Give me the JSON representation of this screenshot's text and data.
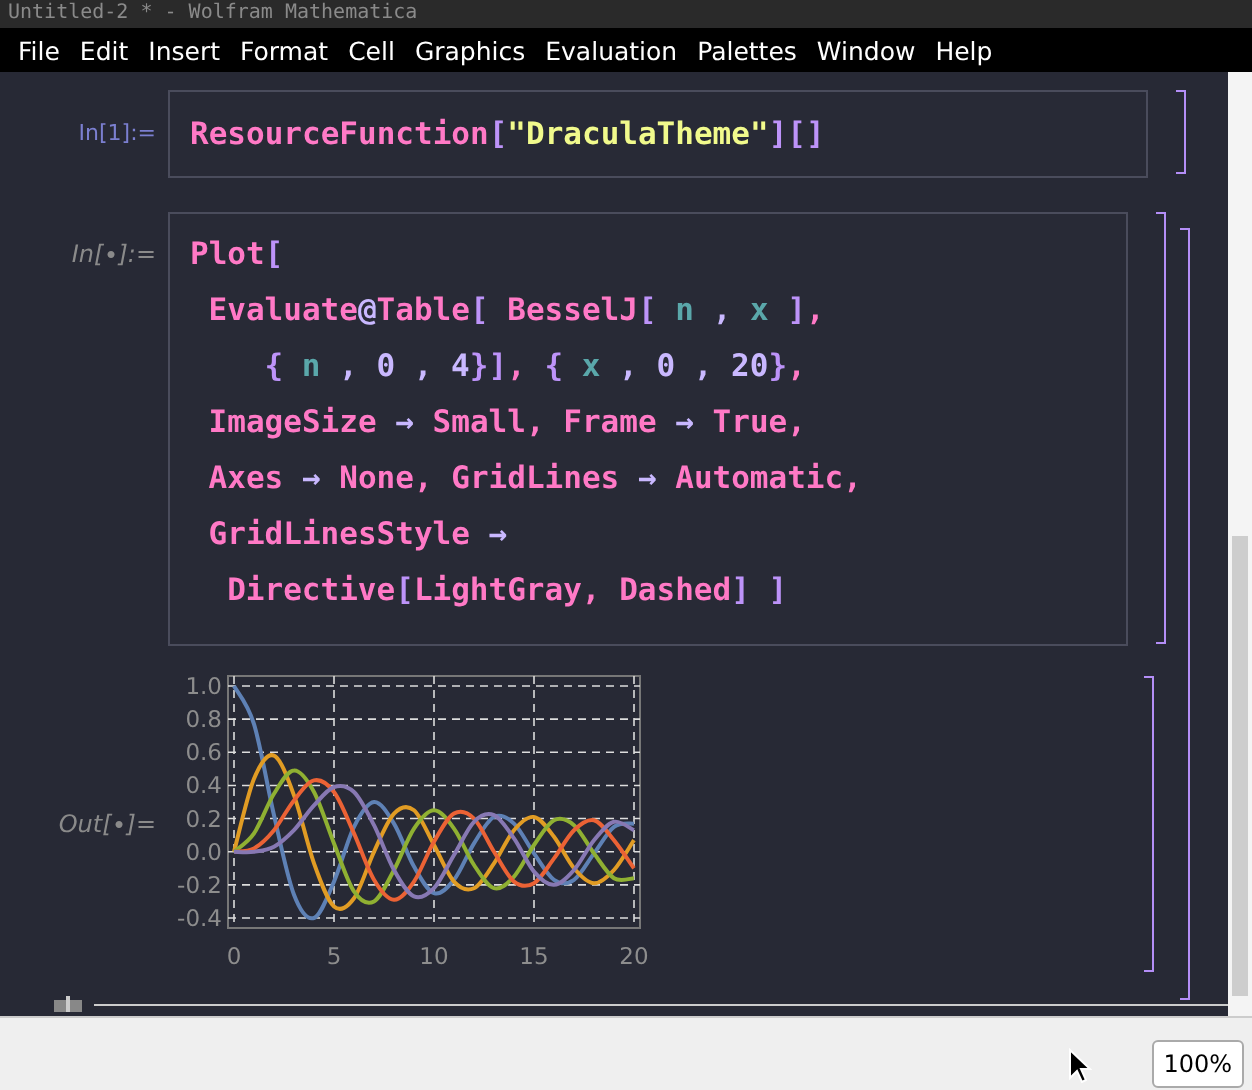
{
  "window": {
    "title": "Untitled-2 * - Wolfram Mathematica"
  },
  "menu": [
    "File",
    "Edit",
    "Insert",
    "Format",
    "Cell",
    "Graphics",
    "Evaluation",
    "Palettes",
    "Window",
    "Help"
  ],
  "cells": [
    {
      "kind": "input",
      "evaluated": true,
      "label": "In[1]:=",
      "lines": [
        [
          {
            "text": "ResourceFunction",
            "kind": "function"
          },
          {
            "text": "[",
            "kind": "bracket"
          },
          {
            "text": "\"DraculaTheme\"",
            "kind": "string"
          },
          {
            "text": "]",
            "kind": "bracket"
          },
          {
            "text": "[]",
            "kind": "bracket"
          }
        ]
      ]
    },
    {
      "kind": "input",
      "evaluated": false,
      "label": "In[∙]:=",
      "lines": [
        [
          {
            "text": "Plot",
            "kind": "function"
          },
          {
            "text": "[",
            "kind": "bracket"
          }
        ],
        [
          {
            "text": "Evaluate",
            "kind": "function"
          },
          {
            "text": "@",
            "kind": "operator"
          },
          {
            "text": "Table",
            "kind": "function"
          },
          {
            "text": "[ ",
            "kind": "bracket"
          },
          {
            "text": "BesselJ",
            "kind": "function"
          },
          {
            "text": "[ ",
            "kind": "bracket"
          },
          {
            "text": "n",
            "kind": "variable"
          },
          {
            "text": " , ",
            "kind": "number"
          },
          {
            "text": "x",
            "kind": "variable"
          },
          {
            "text": " ]",
            "kind": "bracket"
          },
          {
            "text": ",",
            "kind": "punct"
          }
        ],
        [
          {
            "text": "{ ",
            "kind": "bracket"
          },
          {
            "text": "n",
            "kind": "variable"
          },
          {
            "text": " , 0 , 4",
            "kind": "number"
          },
          {
            "text": "}]",
            "kind": "bracket"
          },
          {
            "text": ", ",
            "kind": "punct"
          },
          {
            "text": "{ ",
            "kind": "bracket"
          },
          {
            "text": "x",
            "kind": "variable"
          },
          {
            "text": " , 0 , 20",
            "kind": "number"
          },
          {
            "text": "}",
            "kind": "bracket"
          },
          {
            "text": ",",
            "kind": "punct"
          }
        ],
        [
          {
            "text": "ImageSize",
            "kind": "function"
          },
          {
            "text": " → ",
            "kind": "operator"
          },
          {
            "text": "Small, Frame",
            "kind": "function"
          },
          {
            "text": " → ",
            "kind": "operator"
          },
          {
            "text": "True,",
            "kind": "function"
          }
        ],
        [
          {
            "text": "Axes",
            "kind": "function"
          },
          {
            "text": " → ",
            "kind": "operator"
          },
          {
            "text": "None, GridLines",
            "kind": "function"
          },
          {
            "text": " → ",
            "kind": "operator"
          },
          {
            "text": "Automatic,",
            "kind": "function"
          }
        ],
        [
          {
            "text": "GridLinesStyle",
            "kind": "function"
          },
          {
            "text": " →",
            "kind": "operator"
          }
        ],
        [
          {
            "text": "Directive",
            "kind": "function"
          },
          {
            "text": "[",
            "kind": "bracket"
          },
          {
            "text": "LightGray, Dashed",
            "kind": "function"
          },
          {
            "text": "] ]",
            "kind": "bracket"
          }
        ]
      ]
    },
    {
      "kind": "output",
      "label": "Out[∙]=",
      "chart_data": {
        "type": "line",
        "grid": true,
        "x": [
          0,
          1,
          2,
          3,
          4,
          5,
          6,
          7,
          8,
          9,
          10,
          11,
          12,
          13,
          14,
          15,
          16,
          17,
          18,
          19,
          20
        ],
        "xlim": [
          0,
          20
        ],
        "ylim": [
          -0.4,
          1.0
        ],
        "xticks": [
          0,
          5,
          10,
          15,
          20
        ],
        "yticks": [
          {
            "value": 1.0,
            "label": "1.0"
          },
          {
            "value": 0.8,
            "label": "0.8"
          },
          {
            "value": 0.6,
            "label": "0.6"
          },
          {
            "value": 0.4,
            "label": "0.4"
          },
          {
            "value": 0.2,
            "label": "0.2"
          },
          {
            "value": 0,
            "label": "0.0"
          },
          {
            "value": -0.2,
            "label": "-0.2"
          },
          {
            "value": -0.4,
            "label": "-0.4"
          }
        ],
        "series": [
          {
            "color": "#5e81b5",
            "values": [
              1,
              0.77,
              0.22,
              -0.26,
              -0.4,
              -0.18,
              0.15,
              0.3,
              0.17,
              -0.09,
              -0.25,
              -0.17,
              0.05,
              0.21,
              0.17,
              -0.01,
              -0.17,
              -0.17,
              -0.01,
              0.15,
              0.17
            ]
          },
          {
            "color": "#e19c24",
            "values": [
              0,
              0.44,
              0.58,
              0.34,
              -0.07,
              -0.33,
              -0.28,
              0,
              0.23,
              0.25,
              0.04,
              -0.18,
              -0.22,
              -0.07,
              0.13,
              0.21,
              0.09,
              -0.1,
              -0.19,
              -0.11,
              0.07
            ]
          },
          {
            "color": "#8fb032",
            "values": [
              0,
              0.11,
              0.35,
              0.49,
              0.36,
              0.05,
              -0.24,
              -0.3,
              -0.11,
              0.14,
              0.25,
              0.14,
              -0.08,
              -0.22,
              -0.15,
              0.04,
              0.19,
              0.16,
              -0.01,
              -0.16,
              -0.16
            ]
          },
          {
            "color": "#eb6235",
            "values": [
              0,
              0.02,
              0.13,
              0.31,
              0.43,
              0.36,
              0.11,
              -0.17,
              -0.29,
              -0.18,
              0.06,
              0.23,
              0.2,
              0,
              -0.18,
              -0.19,
              -0.04,
              0.13,
              0.19,
              0.07,
              -0.1
            ]
          },
          {
            "color": "#8778b3",
            "values": [
              0,
              0,
              0.03,
              0.13,
              0.28,
              0.39,
              0.36,
              0.16,
              -0.11,
              -0.27,
              -0.22,
              -0.02,
              0.18,
              0.22,
              0.08,
              -0.12,
              -0.2,
              -0.11,
              0.07,
              0.18,
              0.13
            ]
          }
        ]
      }
    }
  ],
  "status_bar": {
    "zoom": "100%"
  }
}
